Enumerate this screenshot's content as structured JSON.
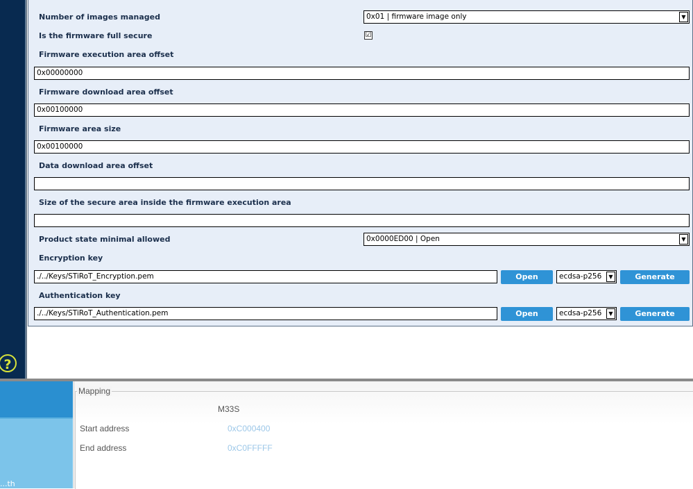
{
  "config": {
    "rows": [
      {
        "label": "Number of images managed",
        "select": "0x01 | firmware image only"
      },
      {
        "label": "Is the firmware full secure",
        "checked": true
      },
      {
        "label": "Firmware execution area offset",
        "value": "0x00000000"
      },
      {
        "label": "Firmware download area offset",
        "value": "0x00100000"
      },
      {
        "label": "Firmware area size",
        "value": "0x00100000"
      },
      {
        "label": "Data download area offset",
        "value": ""
      },
      {
        "label": "Size of the secure area inside the firmware execution area",
        "value": ""
      },
      {
        "label": "Product state minimal allowed",
        "select": "0x0000ED00 | Open"
      },
      {
        "label": "Encryption key",
        "value": "./../Keys/STiRoT_Encryption.pem",
        "open_label": "Open",
        "algo": "ecdsa-p256",
        "generate_label": "Generate"
      },
      {
        "label": "Authentication key",
        "value": "./../Keys/STiRoT_Authentication.pem",
        "open_label": "Open",
        "algo": "ecdsa-p256",
        "generate_label": "Generate"
      }
    ]
  },
  "check_mark": "☑",
  "help_glyph": "?",
  "mapping": {
    "title": "Mapping",
    "column": "M33S",
    "start_label": "Start address",
    "start_value": "0xC000400",
    "end_label": "End address",
    "end_value": "0xC0FFFFF"
  },
  "left_panel_text": "...th",
  "colors": {
    "accent": "#2f93d6",
    "panel": "#e7eef8",
    "sidebar": "#082a50"
  }
}
